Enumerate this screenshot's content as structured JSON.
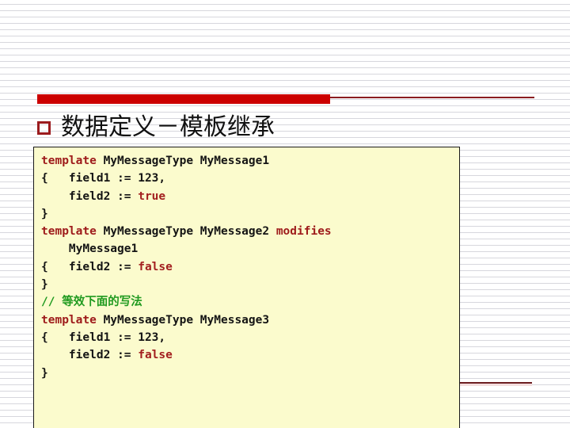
{
  "slide": {
    "title": {
      "bullet": "hollow-square-bullet",
      "text": "数据定义－模板继承"
    },
    "accent_colors": {
      "bar_red": "#cc0000",
      "rule_dark_red": "#8a1c21",
      "bullet_red": "#9b1b1e",
      "code_bg": "#fbfbcd",
      "keyword_red": "#9e1b1b",
      "comment_green": "#1f9a1f",
      "text_black": "#1a1a1a",
      "stripe_gray": "#d7d7dd"
    },
    "code_block": {
      "language": "TTCN-3",
      "lines": [
        [
          {
            "t": "template",
            "c": "kw"
          },
          {
            "t": " MyMessageType MyMessage1",
            "c": "ident"
          }
        ],
        [
          {
            "t": "{   field1 := 123,",
            "c": "ident"
          }
        ],
        [
          {
            "t": "    field2 := ",
            "c": "ident"
          },
          {
            "t": "true",
            "c": "lit"
          }
        ],
        [
          {
            "t": "}",
            "c": "ident"
          }
        ],
        [
          {
            "t": "template",
            "c": "kw"
          },
          {
            "t": " MyMessageType MyMessage2 ",
            "c": "ident"
          },
          {
            "t": "modifies",
            "c": "kw"
          }
        ],
        [
          {
            "t": "    MyMessage1",
            "c": "ident"
          }
        ],
        [
          {
            "t": "{   field2 := ",
            "c": "ident"
          },
          {
            "t": "false",
            "c": "lit"
          }
        ],
        [
          {
            "t": "}",
            "c": "ident"
          }
        ],
        [
          {
            "t": "// 等效下面的写法",
            "c": "cmt"
          }
        ],
        [
          {
            "t": "template",
            "c": "kw"
          },
          {
            "t": " MyMessageType MyMessage3",
            "c": "ident"
          }
        ],
        [
          {
            "t": "{   field1 := 123,",
            "c": "ident"
          }
        ],
        [
          {
            "t": "    field2 := ",
            "c": "ident"
          },
          {
            "t": "false",
            "c": "lit"
          }
        ],
        [
          {
            "t": "}",
            "c": "ident"
          }
        ]
      ]
    }
  }
}
